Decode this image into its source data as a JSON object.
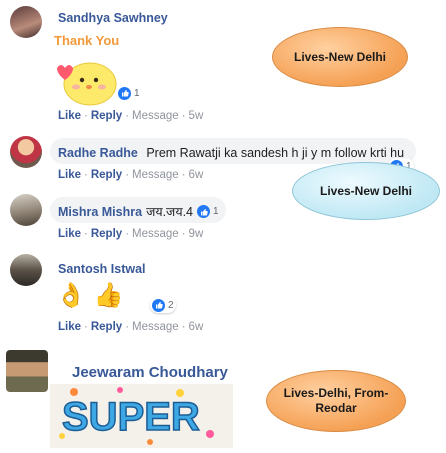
{
  "comments": [
    {
      "author": "Sandhya Sawhney",
      "sticker_text": "Thank You",
      "reactions": "1",
      "actions": {
        "like": "Like",
        "reply": "Reply",
        "message": "Message",
        "time": "5w"
      }
    },
    {
      "author": "Radhe Radhe",
      "text": "Prem Rawatji ka sandesh h ji y m follow krti hu",
      "reactions": "1",
      "actions": {
        "like": "Like",
        "reply": "Reply",
        "message": "Message",
        "time": "6w"
      }
    },
    {
      "author": "Mishra Mishra",
      "text": "जय.जय.4",
      "reactions": "1",
      "actions": {
        "like": "Like",
        "reply": "Reply",
        "message": "Message",
        "time": "9w"
      }
    },
    {
      "author": "Santosh Istwal",
      "emoji": "👌 👍",
      "reactions": "2",
      "actions": {
        "like": "Like",
        "reply": "Reply",
        "message": "Message",
        "time": "6w"
      }
    },
    {
      "author": "Jeewaram Choudhary",
      "image_text": "SUPER"
    }
  ],
  "annotations": [
    {
      "text": "Lives-New Delhi",
      "color": "#f5a155"
    },
    {
      "text": "Lives-New Delhi",
      "color": "#bfe8f4"
    },
    {
      "text": "Lives-Delhi, From-Reodar",
      "color": "#f5a155"
    }
  ],
  "colors": {
    "link": "#385898",
    "bubble": "#f2f3f5",
    "like_blue": "#2078f4"
  }
}
